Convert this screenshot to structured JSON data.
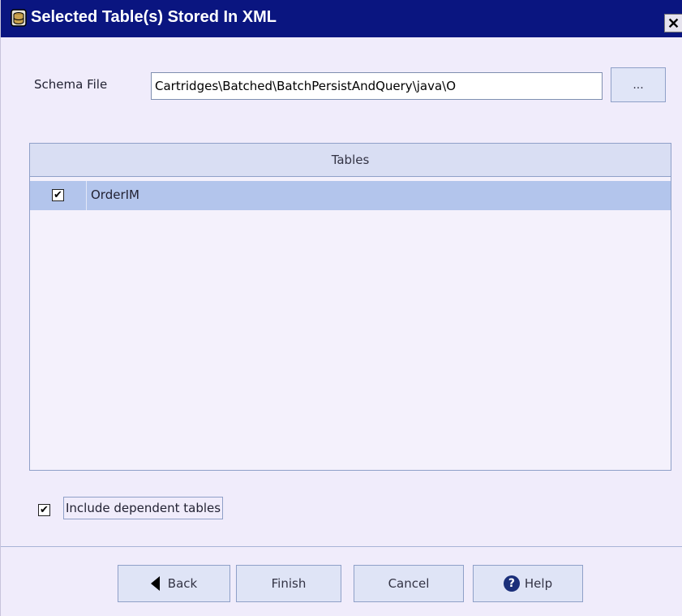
{
  "window": {
    "title": "Selected Table(s) Stored In XML",
    "close_symbol": "✕",
    "title_icon": "database-icon"
  },
  "schema": {
    "label": "Schema File",
    "value": "Cartridges\\Batched\\BatchPersistAndQuery\\java\\O",
    "browse_label": "..."
  },
  "tables": {
    "header": "Tables",
    "rows": [
      {
        "checked": true,
        "check_mark": "✔",
        "name": "OrderIM"
      }
    ]
  },
  "include_dependent": {
    "checked": true,
    "check_mark": "✔",
    "label": "Include dependent tables"
  },
  "buttons": {
    "back_label": "Back",
    "finish_label": "Finish",
    "cancel_label": "Cancel",
    "help_label": "Help",
    "help_glyph": "?"
  },
  "colors": {
    "titlebar": "#0a1580",
    "selected_row": "#b3c5ec",
    "background": "#f0ecfb"
  }
}
